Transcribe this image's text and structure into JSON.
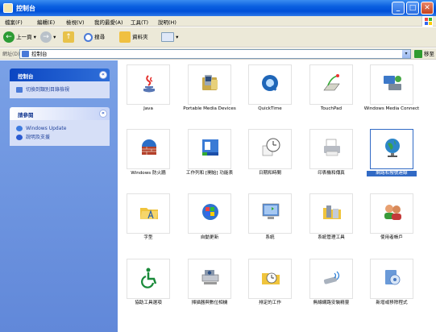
{
  "window": {
    "title": "控制台"
  },
  "menu": [
    "檔案(F)",
    "編輯(E)",
    "檢視(V)",
    "我的最愛(A)",
    "工具(T)",
    "說明(H)"
  ],
  "toolbar": {
    "back": "上一頁",
    "search": "搜尋",
    "folders": "資料夾"
  },
  "address": {
    "label": "網址(D)",
    "value": "控制台",
    "go": "移至"
  },
  "left_panel": {
    "control_panel": {
      "title": "控制台",
      "links": [
        "切換到類別目錄檢視"
      ]
    },
    "see_also": {
      "title": "請參閱",
      "links": [
        "Windows Update",
        "說明及支援"
      ]
    }
  },
  "items": [
    {
      "label": "Java",
      "icon": "java-icon"
    },
    {
      "label": "Portable Media Devices",
      "icon": "portable-media-devices-icon"
    },
    {
      "label": "QuickTime",
      "icon": "quicktime-icon"
    },
    {
      "label": "TouchPad",
      "icon": "touchpad-icon"
    },
    {
      "label": "Windows Media Connect",
      "icon": "windows-media-connect-icon"
    },
    {
      "label": "Windows 防火牆",
      "icon": "firewall-icon"
    },
    {
      "label": "工作列和 [開始] 功能表",
      "icon": "taskbar-icon"
    },
    {
      "label": "日期和時間",
      "icon": "clock-icon"
    },
    {
      "label": "印表機和傳真",
      "icon": "printer-icon"
    },
    {
      "label": "網路和撥號連線",
      "icon": "globe-icon",
      "selected": true
    },
    {
      "label": "字型",
      "icon": "fonts-folder-icon"
    },
    {
      "label": "自動更新",
      "icon": "windows-update-icon"
    },
    {
      "label": "系統",
      "icon": "system-icon"
    },
    {
      "label": "系統管理工具",
      "icon": "admin-tools-icon"
    },
    {
      "label": "使用者帳戶",
      "icon": "user-accounts-icon"
    },
    {
      "label": "協助工具選項",
      "icon": "accessibility-icon"
    },
    {
      "label": "掃描器與數位相機",
      "icon": "scanner-icon"
    },
    {
      "label": "排定的工作",
      "icon": "scheduled-tasks-icon"
    },
    {
      "label": "無線網路安裝精靈",
      "icon": "wireless-icon"
    },
    {
      "label": "新增或移除程式",
      "icon": "add-remove-icon"
    }
  ]
}
